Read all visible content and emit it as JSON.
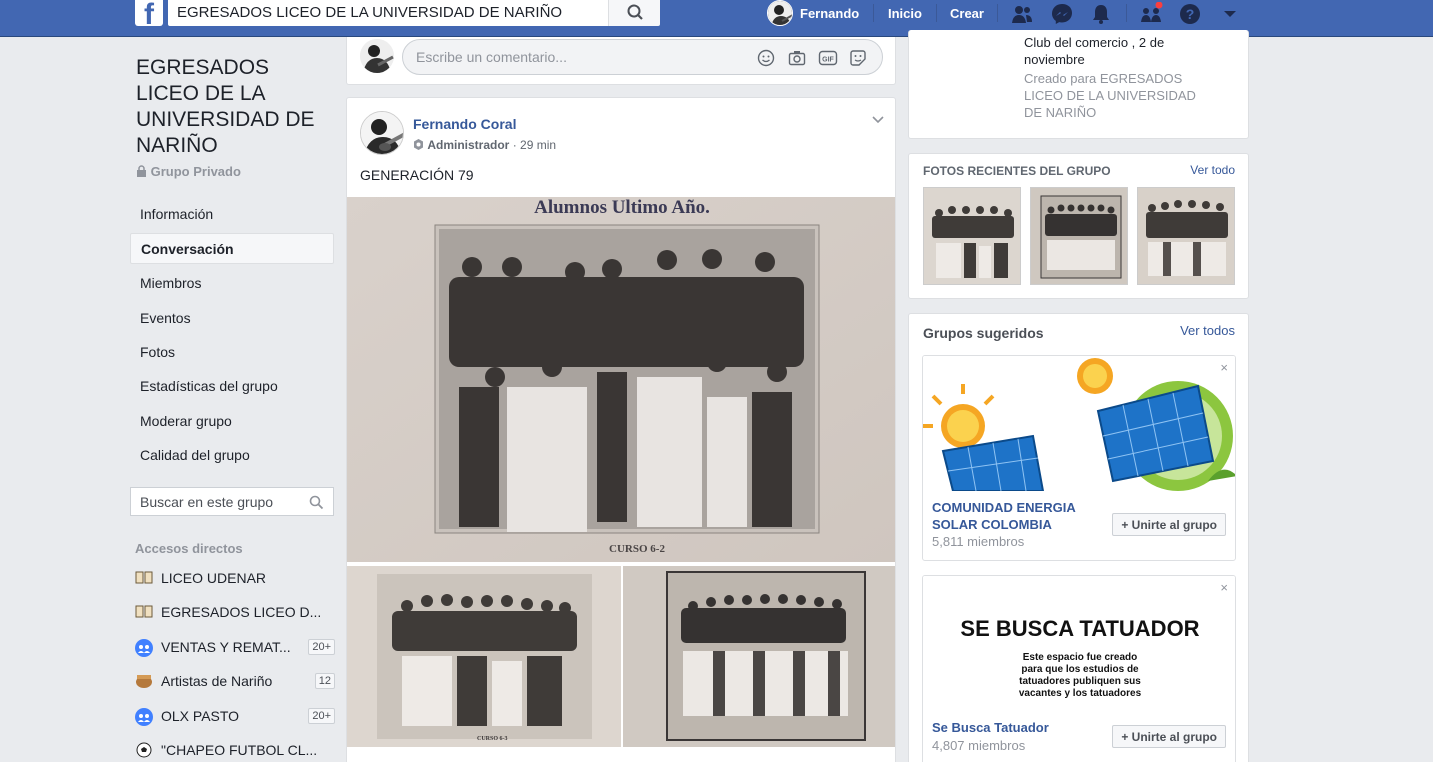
{
  "topbar": {
    "search_value": "EGRESADOS LICEO DE LA UNIVERSIDAD DE NARIÑO",
    "user_name": "Fernando",
    "home": "Inicio",
    "create": "Crear",
    "brand_color": "#4267b2"
  },
  "group": {
    "title": "EGRESADOS LICEO DE LA UNIVERSIDAD DE NARIÑO",
    "privacy": "Grupo Privado"
  },
  "menu": [
    {
      "label": "Información"
    },
    {
      "label": "Conversación",
      "active": true
    },
    {
      "label": "Miembros"
    },
    {
      "label": "Eventos"
    },
    {
      "label": "Fotos"
    },
    {
      "label": "Estadísticas del grupo"
    },
    {
      "label": "Moderar grupo"
    },
    {
      "label": "Calidad del grupo"
    }
  ],
  "group_search_placeholder": "Buscar en este grupo",
  "shortcuts": {
    "heading": "Accesos directos",
    "items": [
      {
        "icon": "book-icon",
        "label": "LICEO UDENAR",
        "count": ""
      },
      {
        "icon": "book-icon",
        "label": "EGRESADOS LICEO D...",
        "count": ""
      },
      {
        "icon": "group-icon",
        "label": "VENTAS Y REMAT...",
        "count": "20+"
      },
      {
        "icon": "artist-icon",
        "label": "Artistas de Nariño",
        "count": "12"
      },
      {
        "icon": "group-icon",
        "label": "OLX PASTO",
        "count": "20+"
      },
      {
        "icon": "soccer-ball-icon",
        "label": "\"CHAPEO FUTBOL CL...",
        "count": ""
      }
    ]
  },
  "comment_bar": {
    "placeholder": "Escribe un comentario..."
  },
  "post": {
    "author": "Fernando Coral",
    "role": "Administrador",
    "time": "29 min",
    "text": "GENERACIÓN 79",
    "photo_caption_top": "Alumnos Ultimo Año.",
    "photo_caption_bottom": "CURSO 6-2",
    "thumb_caption_1": "CURSO 6-3"
  },
  "event_card": {
    "line1": "Club del comercio , 2 de",
    "line2": "noviembre",
    "created_for": "Creado para EGRESADOS LICEO DE LA UNIVERSIDAD DE NARIÑO"
  },
  "recent_photos": {
    "heading": "FOTOS RECIENTES DEL GRUPO",
    "link": "Ver todo"
  },
  "suggested": {
    "heading": "Grupos sugeridos",
    "link": "Ver todos",
    "items": [
      {
        "name_line1": "COMUNIDAD ENERGIA",
        "name_line2": "SOLAR COLOMBIA",
        "members": "5,811 miembros",
        "button": "Unirte al grupo"
      },
      {
        "name_line1": "Se Busca Tatuador",
        "name_line2": "",
        "members": "4,807 miembros",
        "button": "Unirte al grupo",
        "banner_title": "SE BUSCA TATUADOR",
        "banner_line1": "Este espacio fue creado",
        "banner_line2": "para que los estudios de",
        "banner_line3": "tatuadores publiquen sus",
        "banner_line4": "vacantes y los tatuadores"
      }
    ]
  }
}
